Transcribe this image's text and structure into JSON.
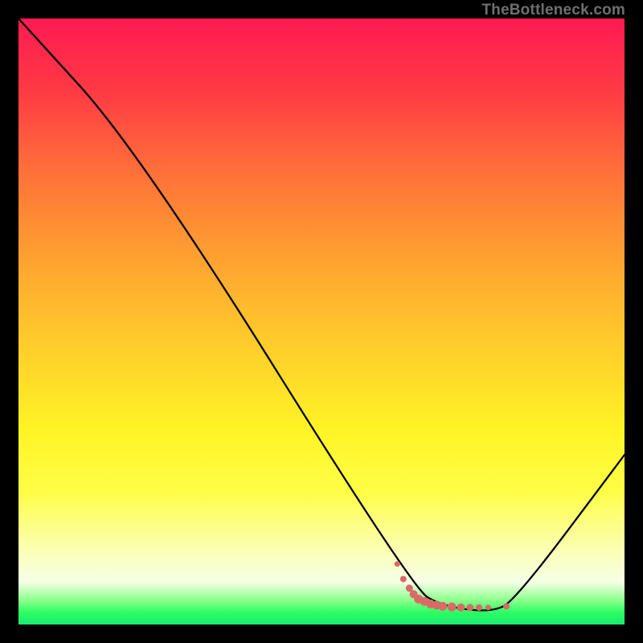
{
  "watermark": "TheBottleneck.com",
  "chart_data": {
    "type": "line",
    "title": "",
    "xlabel": "",
    "ylabel": "",
    "ylim": [
      0,
      100
    ],
    "xlim": [
      0,
      100
    ],
    "gradient_colors": [
      "#ff1a51",
      "#ffd829",
      "#2cff62"
    ],
    "series": [
      {
        "name": "bottleneck-curve",
        "x": [
          0,
          20,
          65,
          70,
          78,
          82,
          100
        ],
        "y": [
          100,
          78,
          6,
          3,
          2,
          4,
          28
        ]
      }
    ],
    "markers": {
      "name": "dotted-segment",
      "color": "#d96a66",
      "x": [
        62.5,
        63.5,
        64.5,
        65.2,
        66.0,
        67.0,
        68.0,
        69.0,
        70.0,
        71.5,
        73.0,
        74.5,
        76.0,
        77.5,
        80.5
      ],
      "y": [
        10.0,
        7.5,
        6.0,
        5.0,
        4.2,
        3.8,
        3.4,
        3.2,
        3.0,
        2.9,
        2.8,
        2.8,
        2.8,
        2.8,
        3.0
      ],
      "r": [
        3.5,
        4.0,
        4.5,
        5.0,
        5.5,
        5.5,
        5.5,
        5.5,
        5.5,
        5.5,
        5.0,
        4.5,
        4.0,
        3.5,
        4.0
      ]
    }
  }
}
